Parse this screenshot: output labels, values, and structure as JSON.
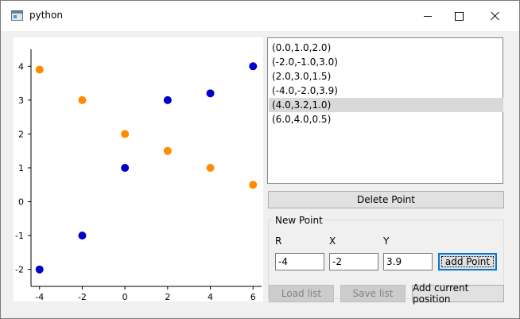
{
  "window": {
    "title": "python"
  },
  "chart_data": {
    "type": "scatter",
    "xlim": [
      -4.4,
      6.4
    ],
    "ylim": [
      -2.5,
      4.5
    ],
    "xticks": [
      -4,
      -2,
      0,
      2,
      4,
      6
    ],
    "yticks": [
      -2,
      -1,
      0,
      1,
      2,
      3,
      4
    ],
    "grid": false,
    "series": [
      {
        "color": "#ff8c00",
        "x": [
          -4,
          -2,
          0,
          2,
          4,
          6
        ],
        "y": [
          3.9,
          3.0,
          2.0,
          1.5,
          1.0,
          0.5
        ]
      },
      {
        "color": "#0000cd",
        "x": [
          -4,
          -2,
          0,
          2,
          4,
          6
        ],
        "y": [
          -2.0,
          -1.0,
          1.0,
          3.0,
          3.2,
          4.0
        ]
      }
    ]
  },
  "point_list": {
    "items": [
      "(0.0,1.0,2.0)",
      "(-2.0,-1.0,3.0)",
      "(2.0,3.0,1.5)",
      "(-4.0,-2.0,3.9)",
      "(4.0,3.2,1.0)",
      "(6.0,4.0,0.5)"
    ],
    "selected_index": 4
  },
  "buttons": {
    "delete_point": "Delete Point",
    "add_point": "add Point",
    "load_list": "Load list",
    "save_list": "Save list",
    "add_current_position": "Add current position"
  },
  "new_point": {
    "group_title": "New Point",
    "r_label": "R",
    "x_label": "X",
    "y_label": "Y",
    "r_value": "-4",
    "x_value": "-2",
    "y_value": "3.9"
  }
}
